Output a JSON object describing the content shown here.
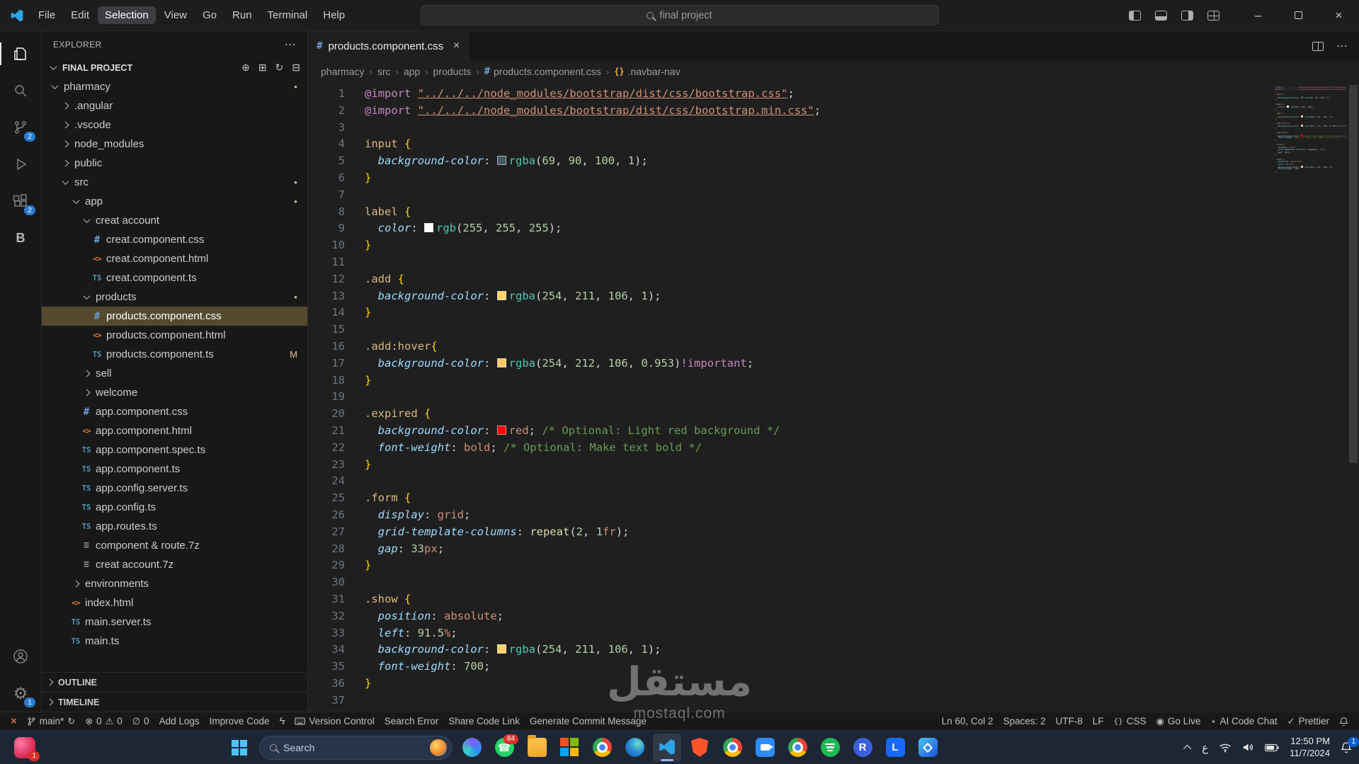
{
  "colors": {
    "accent": "#0078d4",
    "modified": "#E2C08D",
    "selection_bg": "#554930",
    "taskbar_bg": "#1d2634"
  },
  "titlebar": {
    "menus": [
      "File",
      "Edit",
      "Selection",
      "View",
      "Go",
      "Run",
      "Terminal",
      "Help"
    ],
    "active_menu": "Selection",
    "search_value": "final project"
  },
  "activity_bar": {
    "items": [
      {
        "name": "explorer",
        "active": true
      },
      {
        "name": "search"
      },
      {
        "name": "source-control",
        "badge": "2"
      },
      {
        "name": "run-and-debug"
      },
      {
        "name": "extensions",
        "badge": "2"
      },
      {
        "name": "extension-b",
        "label": "B"
      }
    ],
    "bottom": [
      {
        "name": "accounts"
      },
      {
        "name": "settings",
        "badge": "1"
      }
    ]
  },
  "sidebar": {
    "title": "EXPLORER",
    "project": "FINAL PROJECT",
    "sections": [
      "OUTLINE",
      "TIMELINE"
    ],
    "items": [
      {
        "label": "pharmacy",
        "level": 0,
        "chevron": "down",
        "badge": "dot"
      },
      {
        "label": ".angular",
        "level": 1,
        "chevron": "right"
      },
      {
        "label": ".vscode",
        "level": 1,
        "chevron": "right"
      },
      {
        "label": "node_modules",
        "level": 1,
        "chevron": "right"
      },
      {
        "label": "public",
        "level": 1,
        "chevron": "right"
      },
      {
        "label": "src",
        "level": 1,
        "chevron": "down",
        "badge": "dot"
      },
      {
        "label": "app",
        "level": 2,
        "chevron": "down",
        "badge": "dot"
      },
      {
        "label": "creat account",
        "level": 3,
        "chevron": "down"
      },
      {
        "label": "creat.component.css",
        "level": 4,
        "icon": "css"
      },
      {
        "label": "creat.component.html",
        "level": 4,
        "icon": "html"
      },
      {
        "label": "creat.component.ts",
        "level": 4,
        "icon": "ts"
      },
      {
        "label": "products",
        "level": 3,
        "chevron": "down",
        "badge": "dot"
      },
      {
        "label": "products.component.css",
        "level": 4,
        "icon": "css",
        "selected": true
      },
      {
        "label": "products.component.html",
        "level": 4,
        "icon": "html"
      },
      {
        "label": "products.component.ts",
        "level": 4,
        "icon": "ts",
        "badge": "M"
      },
      {
        "label": "sell",
        "level": 3,
        "chevron": "right"
      },
      {
        "label": "welcome",
        "level": 3,
        "chevron": "right"
      },
      {
        "label": "app.component.css",
        "level": 3,
        "icon": "css"
      },
      {
        "label": "app.component.html",
        "level": 3,
        "icon": "html"
      },
      {
        "label": "app.component.spec.ts",
        "level": 3,
        "icon": "ts"
      },
      {
        "label": "app.component.ts",
        "level": 3,
        "icon": "ts"
      },
      {
        "label": "app.config.server.ts",
        "level": 3,
        "icon": "ts"
      },
      {
        "label": "app.config.ts",
        "level": 3,
        "icon": "ts"
      },
      {
        "label": "app.routes.ts",
        "level": 3,
        "icon": "ts"
      },
      {
        "label": "component & route.7z",
        "level": 3,
        "icon": "zip"
      },
      {
        "label": "creat account.7z",
        "level": 3,
        "icon": "zip"
      },
      {
        "label": "environments",
        "level": 2,
        "chevron": "right"
      },
      {
        "label": "index.html",
        "level": 2,
        "icon": "html"
      },
      {
        "label": "main.server.ts",
        "level": 2,
        "icon": "ts"
      },
      {
        "label": "main.ts",
        "level": 2,
        "icon": "ts"
      }
    ]
  },
  "editor": {
    "tab": {
      "label": "products.component.css"
    },
    "breadcrumbs": [
      {
        "label": "pharmacy"
      },
      {
        "label": "src"
      },
      {
        "label": "app"
      },
      {
        "label": "products"
      },
      {
        "label": "products.component.css",
        "icon": "css"
      },
      {
        "label": ".navbar-nav",
        "icon": "symbol"
      }
    ],
    "lines": [
      [
        [
          "kw",
          "@import"
        ],
        [
          "pl",
          " "
        ],
        [
          "str",
          "\"../../../node_modules/bootstrap/dist/css/bootstrap.css\""
        ],
        [
          "pl",
          ";"
        ]
      ],
      [
        [
          "kw",
          "@import"
        ],
        [
          "pl",
          " "
        ],
        [
          "str",
          "\"../../../node_modules/bootstrap/dist/css/bootstrap.min.css\""
        ],
        [
          "pl",
          ";"
        ]
      ],
      [],
      [
        [
          "sel",
          "input"
        ],
        [
          "pl",
          " "
        ],
        [
          "br",
          "{"
        ]
      ],
      [
        [
          "pl",
          "  "
        ],
        [
          "prop",
          "background-color"
        ],
        [
          "pl",
          ": "
        ],
        [
          "swatch",
          "#455A64"
        ],
        [
          "fn",
          "rgba"
        ],
        [
          "pl",
          "("
        ],
        [
          "num",
          "69"
        ],
        [
          "pl",
          ", "
        ],
        [
          "num",
          "90"
        ],
        [
          "pl",
          ", "
        ],
        [
          "num",
          "100"
        ],
        [
          "pl",
          ", "
        ],
        [
          "num",
          "1"
        ],
        [
          "pl",
          ");"
        ]
      ],
      [
        [
          "br",
          "}"
        ]
      ],
      [],
      [
        [
          "sel",
          "label"
        ],
        [
          "pl",
          " "
        ],
        [
          "br",
          "{"
        ]
      ],
      [
        [
          "pl",
          "  "
        ],
        [
          "prop",
          "color"
        ],
        [
          "pl",
          ": "
        ],
        [
          "swatch",
          "#FFFFFF"
        ],
        [
          "fn",
          "rgb"
        ],
        [
          "pl",
          "("
        ],
        [
          "num",
          "255"
        ],
        [
          "pl",
          ", "
        ],
        [
          "num",
          "255"
        ],
        [
          "pl",
          ", "
        ],
        [
          "num",
          "255"
        ],
        [
          "pl",
          ");"
        ]
      ],
      [
        [
          "br",
          "}"
        ]
      ],
      [],
      [
        [
          "sel",
          ".add"
        ],
        [
          "pl",
          " "
        ],
        [
          "br",
          "{"
        ]
      ],
      [
        [
          "pl",
          "  "
        ],
        [
          "prop",
          "background-color"
        ],
        [
          "pl",
          ": "
        ],
        [
          "swatch",
          "#FED36A"
        ],
        [
          "fn",
          "rgba"
        ],
        [
          "pl",
          "("
        ],
        [
          "num",
          "254"
        ],
        [
          "pl",
          ", "
        ],
        [
          "num",
          "211"
        ],
        [
          "pl",
          ", "
        ],
        [
          "num",
          "106"
        ],
        [
          "pl",
          ", "
        ],
        [
          "num",
          "1"
        ],
        [
          "pl",
          ");"
        ]
      ],
      [
        [
          "br",
          "}"
        ]
      ],
      [],
      [
        [
          "sel",
          ".add:hover"
        ],
        [
          "br",
          "{"
        ]
      ],
      [
        [
          "pl",
          "  "
        ],
        [
          "prop",
          "background-color"
        ],
        [
          "pl",
          ": "
        ],
        [
          "swatch",
          "rgba(254,212,106,0.953)"
        ],
        [
          "fn",
          "rgba"
        ],
        [
          "pl",
          "("
        ],
        [
          "num",
          "254"
        ],
        [
          "pl",
          ", "
        ],
        [
          "num",
          "212"
        ],
        [
          "pl",
          ", "
        ],
        [
          "num",
          "106"
        ],
        [
          "pl",
          ", "
        ],
        [
          "num",
          "0.953"
        ],
        [
          "pl",
          ")"
        ],
        [
          "imp",
          "!important"
        ],
        [
          "pl",
          ";"
        ]
      ],
      [
        [
          "br",
          "}"
        ]
      ],
      [],
      [
        [
          "sel",
          ".expired"
        ],
        [
          "pl",
          " "
        ],
        [
          "br",
          "{"
        ]
      ],
      [
        [
          "pl",
          "  "
        ],
        [
          "prop",
          "background-color"
        ],
        [
          "pl",
          ": "
        ],
        [
          "swatch",
          "#FF0000"
        ],
        [
          "val",
          "red"
        ],
        [
          "pl",
          "; "
        ],
        [
          "com",
          "/* Optional: Light red background */"
        ]
      ],
      [
        [
          "pl",
          "  "
        ],
        [
          "prop",
          "font-weight"
        ],
        [
          "pl",
          ": "
        ],
        [
          "val",
          "bold"
        ],
        [
          "pl",
          "; "
        ],
        [
          "com",
          "/* Optional: Make text bold */"
        ]
      ],
      [
        [
          "br",
          "}"
        ]
      ],
      [],
      [
        [
          "sel",
          ".form"
        ],
        [
          "pl",
          " "
        ],
        [
          "br",
          "{"
        ]
      ],
      [
        [
          "pl",
          "  "
        ],
        [
          "prop",
          "display"
        ],
        [
          "pl",
          ": "
        ],
        [
          "val",
          "grid"
        ],
        [
          "pl",
          ";"
        ]
      ],
      [
        [
          "pl",
          "  "
        ],
        [
          "prop",
          "grid-template-columns"
        ],
        [
          "pl",
          ": "
        ],
        [
          "fn2",
          "repeat"
        ],
        [
          "pl",
          "("
        ],
        [
          "num",
          "2"
        ],
        [
          "pl",
          ", "
        ],
        [
          "num",
          "1"
        ],
        [
          "unit",
          "fr"
        ],
        [
          "pl",
          ");"
        ]
      ],
      [
        [
          "pl",
          "  "
        ],
        [
          "prop",
          "gap"
        ],
        [
          "pl",
          ": "
        ],
        [
          "num",
          "33"
        ],
        [
          "unit",
          "px"
        ],
        [
          "pl",
          ";"
        ]
      ],
      [
        [
          "br",
          "}"
        ]
      ],
      [],
      [
        [
          "sel",
          ".show"
        ],
        [
          "pl",
          " "
        ],
        [
          "br",
          "{"
        ]
      ],
      [
        [
          "pl",
          "  "
        ],
        [
          "prop",
          "position"
        ],
        [
          "pl",
          ": "
        ],
        [
          "val",
          "absolute"
        ],
        [
          "pl",
          ";"
        ]
      ],
      [
        [
          "pl",
          "  "
        ],
        [
          "prop",
          "left"
        ],
        [
          "pl",
          ": "
        ],
        [
          "num",
          "91.5"
        ],
        [
          "unit",
          "%"
        ],
        [
          "pl",
          ";"
        ]
      ],
      [
        [
          "pl",
          "  "
        ],
        [
          "prop",
          "background-color"
        ],
        [
          "pl",
          ": "
        ],
        [
          "swatch",
          "#FED36A"
        ],
        [
          "fn",
          "rgba"
        ],
        [
          "pl",
          "("
        ],
        [
          "num",
          "254"
        ],
        [
          "pl",
          ", "
        ],
        [
          "num",
          "211"
        ],
        [
          "pl",
          ", "
        ],
        [
          "num",
          "106"
        ],
        [
          "pl",
          ", "
        ],
        [
          "num",
          "1"
        ],
        [
          "pl",
          ");"
        ]
      ],
      [
        [
          "pl",
          "  "
        ],
        [
          "prop",
          "font-weight"
        ],
        [
          "pl",
          ": "
        ],
        [
          "num",
          "700"
        ],
        [
          "pl",
          ";"
        ]
      ],
      [
        [
          "br",
          "}"
        ]
      ],
      []
    ]
  },
  "statusbar": {
    "left": [
      {
        "name": "remote-indicator",
        "icon": "remote",
        "label": ""
      },
      {
        "name": "git-branch",
        "icon": "branch",
        "label": "main*",
        "icon2": "sync"
      },
      {
        "name": "problems",
        "icon": "error",
        "label": "0",
        "icon2": "warning",
        "label2": "0"
      },
      {
        "name": "notifications-muted",
        "icon": "bellslash",
        "label": "0"
      },
      {
        "name": "add-logs",
        "label": "Add Logs"
      },
      {
        "name": "improve-code",
        "label": "Improve Code"
      },
      {
        "name": "thunder-client",
        "icon": "bolt",
        "label": ""
      },
      {
        "name": "version-control",
        "icon": "keyboard",
        "label": "Version Control"
      },
      {
        "name": "search-error",
        "label": "Search Error"
      },
      {
        "name": "share-code-link",
        "label": "Share Code Link"
      },
      {
        "name": "generate-commit-message",
        "label": "Generate Commit Message"
      }
    ],
    "right": [
      {
        "name": "cursor-position",
        "label": "Ln 60, Col 2"
      },
      {
        "name": "indentation",
        "label": "Spaces: 2"
      },
      {
        "name": "encoding",
        "label": "UTF-8"
      },
      {
        "name": "eol",
        "label": "LF"
      },
      {
        "name": "language-mode",
        "icon": "braces",
        "label": "CSS"
      },
      {
        "name": "go-live",
        "icon": "broadcast",
        "label": "Go Live"
      },
      {
        "name": "ai-code-chat",
        "icon": "spark",
        "label": "AI Code Chat"
      },
      {
        "name": "prettier",
        "icon": "check",
        "label": "Prettier"
      },
      {
        "name": "notifications",
        "icon": "bell",
        "label": ""
      }
    ]
  },
  "taskbar": {
    "search_label": "Search",
    "apps": [
      {
        "name": "copilot"
      },
      {
        "name": "whatsapp",
        "badge": "84"
      },
      {
        "name": "file-explorer"
      },
      {
        "name": "microsoft-365"
      },
      {
        "name": "chrome-1"
      },
      {
        "name": "edge"
      },
      {
        "name": "vscode",
        "active": true
      },
      {
        "name": "brave"
      },
      {
        "name": "chrome-2"
      },
      {
        "name": "zoom"
      },
      {
        "name": "chrome-3"
      },
      {
        "name": "spotify"
      },
      {
        "name": "app-r",
        "letter": "R"
      },
      {
        "name": "app-l",
        "letter": "L"
      },
      {
        "name": "photos"
      }
    ],
    "corner_badge": "1",
    "tray": {
      "language": "ع",
      "time": "12:50 PM",
      "date": "11/7/2024",
      "notification_badge": "1"
    }
  },
  "watermark": {
    "text": "مستقل",
    "domain": "mostaql.com"
  }
}
